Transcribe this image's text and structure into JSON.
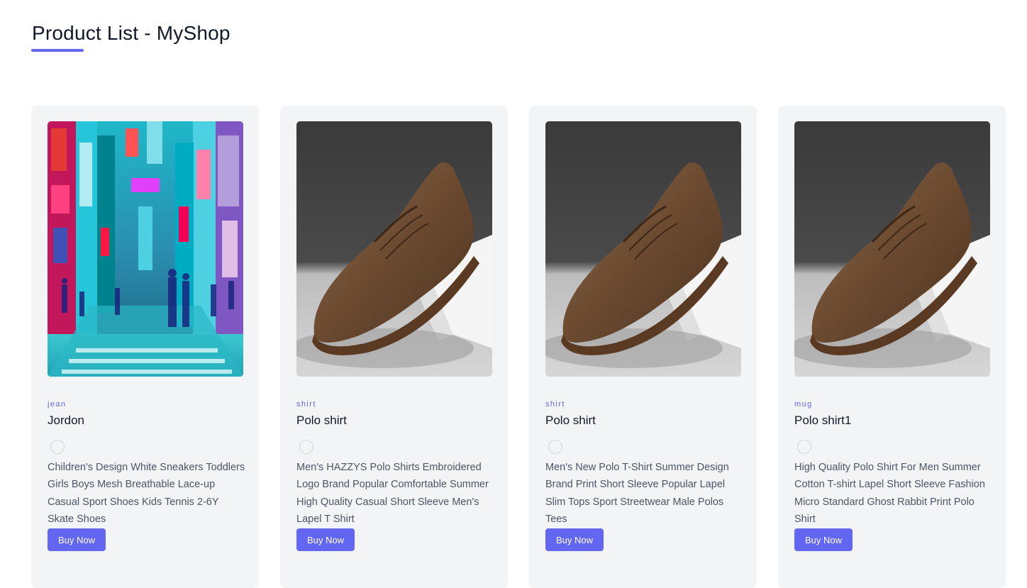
{
  "page": {
    "title": "Product List - MyShop",
    "accent_color": "#6366f1"
  },
  "products": [
    {
      "category": "jean",
      "name": "Jordon",
      "image": "street-scene-image",
      "description": "Children's Design White Sneakers Toddlers Girls Boys Mesh Breathable Lace-up Casual Sport Shoes Kids Tennis 2-6Y Skate Shoes",
      "button_label": "Buy Now"
    },
    {
      "category": "shirt",
      "name": "Polo shirt",
      "image": "brown-shoe-image",
      "description": "Men's HAZZYS Polo Shirts Embroidered Logo Brand Popular Comfortable Summer High Quality Casual Short Sleeve Men's Lapel T Shirt",
      "button_label": "Buy Now"
    },
    {
      "category": "shirt",
      "name": "Polo shirt",
      "image": "brown-shoe-image",
      "description": "Men's New Polo T-Shirt Summer Design Brand Print Short Sleeve Popular Lapel Slim Tops Sport Streetwear Male Polos Tees",
      "button_label": "Buy Now"
    },
    {
      "category": "mug",
      "name": "Polo shirt1",
      "image": "brown-shoe-image",
      "description": "High Quality Polo Shirt For Men Summer Cotton T-shirt Lapel Short Sleeve Fashion Micro Standard Ghost Rabbit Print Polo Shirt",
      "button_label": "Buy Now"
    }
  ]
}
